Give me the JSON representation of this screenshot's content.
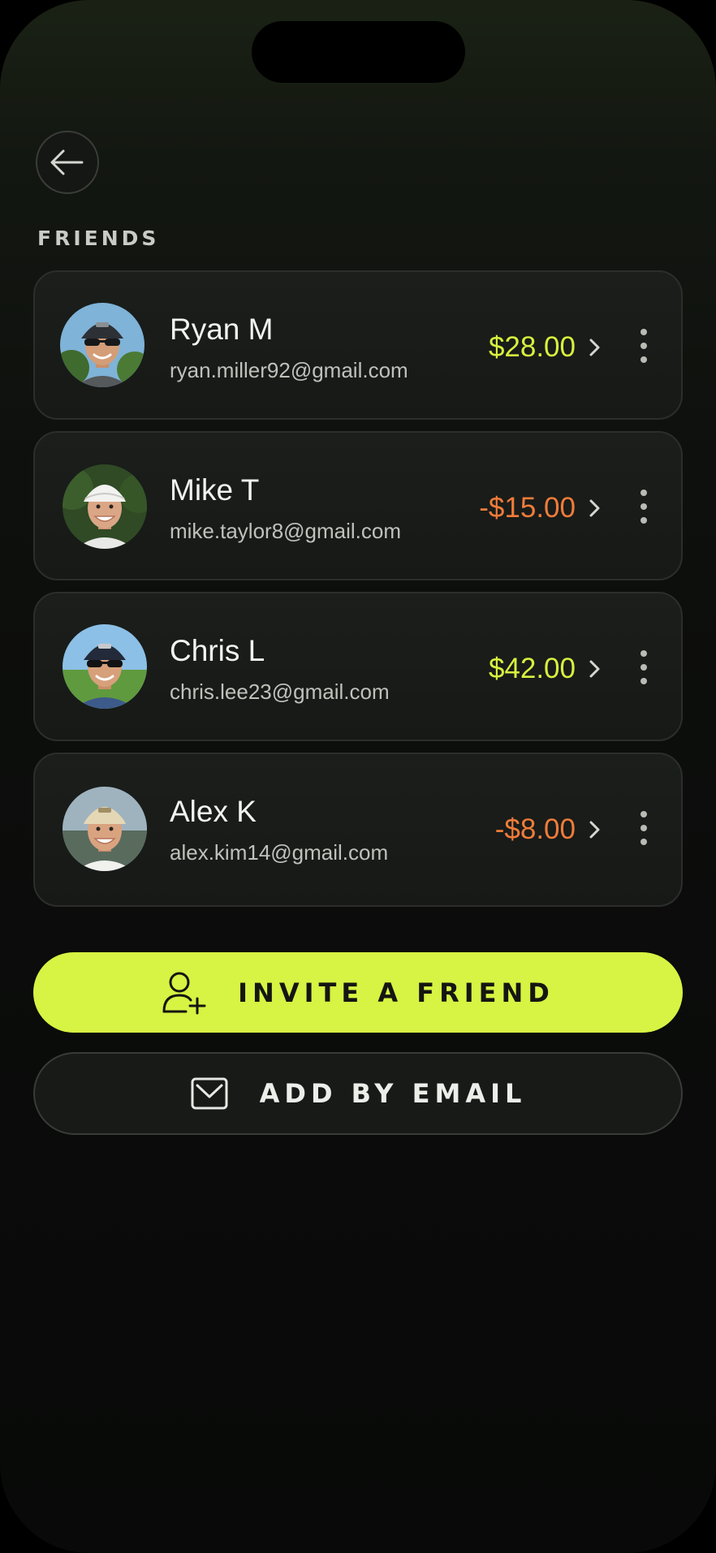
{
  "header": {
    "back_icon": "arrow-left-icon",
    "section_title": "FRIENDS"
  },
  "friends": [
    {
      "name": "Ryan M",
      "email": "ryan.miller92@gmail.com",
      "balance": "$28.00",
      "balance_sign": "positive",
      "avatar": "avatar-ryan"
    },
    {
      "name": "Mike T",
      "email": "mike.taylor8@gmail.com",
      "balance": "-$15.00",
      "balance_sign": "negative",
      "avatar": "avatar-mike"
    },
    {
      "name": "Chris L",
      "email": "chris.lee23@gmail.com",
      "balance": "$42.00",
      "balance_sign": "positive",
      "avatar": "avatar-chris"
    },
    {
      "name": "Alex K",
      "email": "alex.kim14@gmail.com",
      "balance": "-$8.00",
      "balance_sign": "negative",
      "avatar": "avatar-alex"
    }
  ],
  "actions": {
    "invite_label": "INVITE A FRIEND",
    "invite_icon": "user-plus-icon",
    "email_label": "ADD BY EMAIL",
    "email_icon": "envelope-icon"
  },
  "colors": {
    "accent": "#d7f343",
    "positive": "#d8f03e",
    "negative": "#f07c3a",
    "background": "#0b0c0b"
  }
}
